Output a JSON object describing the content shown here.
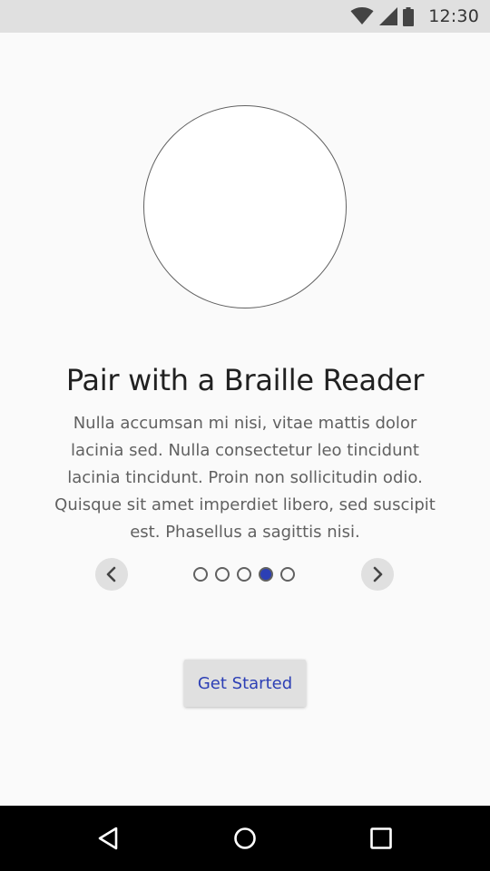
{
  "status_bar": {
    "time": "12:30",
    "icons": [
      "wifi-icon",
      "cell-signal-icon",
      "battery-icon"
    ]
  },
  "onboarding": {
    "image": "placeholder-circle",
    "title": "Pair with a Braille Reader",
    "body": "Nulla accumsan mi nisi, vitae mattis dolor lacinia sed. Nulla consectetur leo tincidunt lacinia tincidunt. Proin non sollicitudin odio. Quisque sit amet imperdiet libero, sed suscipit est. Phasellus a sagittis nisi.",
    "pager": {
      "total_pages": 5,
      "current_page": 4,
      "prev_icon": "chevron-left-icon",
      "next_icon": "chevron-right-icon"
    },
    "cta_label": "Get Started"
  },
  "nav_bar": {
    "icons": [
      "back-icon",
      "home-icon",
      "recents-icon"
    ]
  },
  "colors": {
    "accent": "#2c3fb5",
    "background": "#fafafa",
    "status_bar": "#e0e0e0",
    "nav_bar": "#000000",
    "button_bg": "#e0e0e0"
  }
}
